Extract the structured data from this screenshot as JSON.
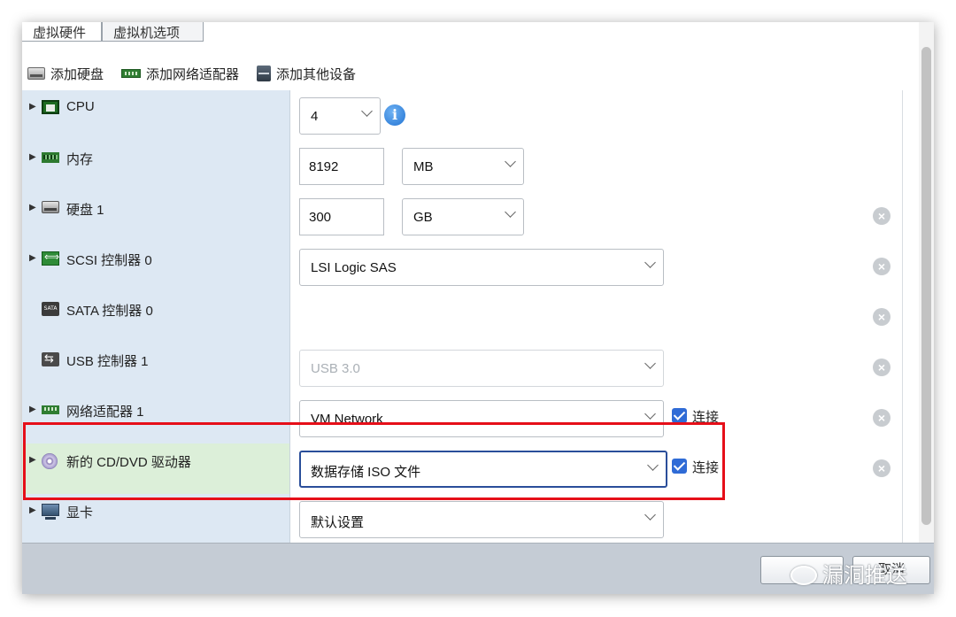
{
  "tabs": [
    {
      "label": "虚拟硬件"
    },
    {
      "label": "虚拟机选项"
    }
  ],
  "toolbar": {
    "add_disk": "添加硬盘",
    "add_network": "添加网络适配器",
    "add_other": "添加其他设备"
  },
  "rows": {
    "cpu": {
      "label": "CPU",
      "value": "4"
    },
    "memory": {
      "label": "内存",
      "value": "8192",
      "unit": "MB"
    },
    "disk": {
      "label": "硬盘 1",
      "value": "300",
      "unit": "GB"
    },
    "scsi": {
      "label": "SCSI 控制器 0",
      "value": "LSI Logic SAS"
    },
    "sata": {
      "label": "SATA 控制器 0"
    },
    "usb": {
      "label": "USB 控制器 1",
      "value": "USB 3.0"
    },
    "network": {
      "label": "网络适配器 1",
      "value": "VM Network",
      "connect_label": "连接"
    },
    "cddvd": {
      "label": "新的 CD/DVD 驱动器",
      "value": "数据存储 ISO 文件",
      "connect_label": "连接"
    },
    "video": {
      "label": "显卡",
      "value": "默认设置"
    }
  },
  "icons": {
    "info": "i",
    "remove": "×",
    "sata_text": "SATA"
  },
  "footer": {
    "cancel_label": "取消"
  },
  "watermark": {
    "text": "漏洞推送"
  },
  "colors": {
    "highlight": "#e60f19",
    "focus": "#2a4e9a",
    "checkbox": "#2f6bd6"
  }
}
